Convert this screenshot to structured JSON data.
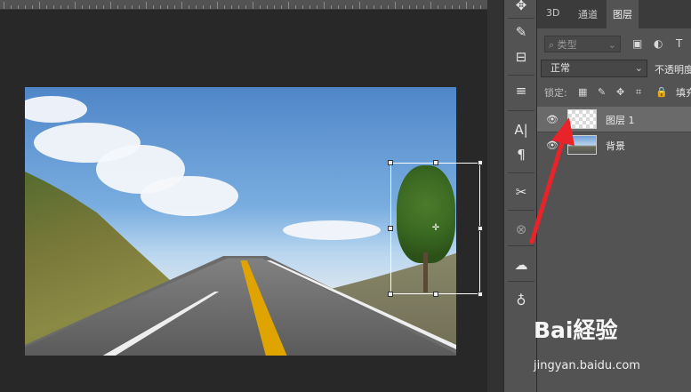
{
  "panel": {
    "tabs": [
      "3D",
      "通道",
      "图层"
    ],
    "active_tab": "图层",
    "filter_placeholder": "类型",
    "blend_mode": "正常",
    "opacity_label": "不透明度",
    "lock_label": "锁定:",
    "fill_label": "填充",
    "layers": [
      {
        "name": "图层 1",
        "visible": true,
        "selected": true,
        "thumbnail": "transparent-checker"
      },
      {
        "name": "背景",
        "visible": true,
        "selected": false,
        "thumbnail": "road-photo"
      }
    ]
  },
  "toolbar": {
    "icons": [
      "move-icon",
      "brush-settings-icon",
      "adjust-icon",
      "clone-source-icon",
      "character-icon",
      "paragraph-icon",
      "tools-icon",
      "3d-icon",
      "creative-cloud-icon",
      "learn-icon"
    ],
    "glyphs": [
      "✥",
      "✎",
      "⊟",
      "≡",
      "A|",
      "¶",
      "✂",
      "⊗",
      "☁",
      "♁"
    ]
  },
  "watermark": {
    "logo": "Bai経验",
    "url": "jingyan.baidu.com"
  },
  "colors": {
    "workspace": "#282828",
    "panel": "#535353",
    "arrow": "#e8242a",
    "selected_layer": "#6a6a6a"
  }
}
